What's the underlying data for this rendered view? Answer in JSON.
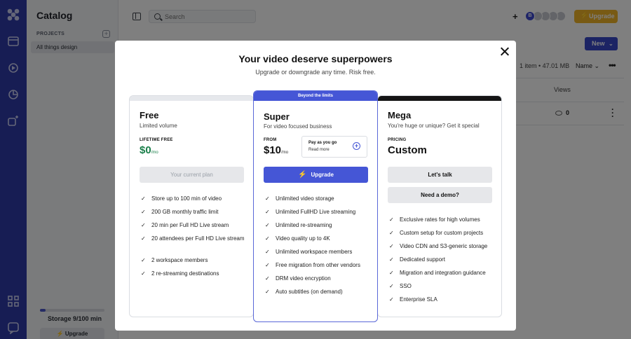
{
  "sidebar": {
    "title": "Catalog",
    "projects_label": "PROJECTS",
    "item": "All things design",
    "storage_text": "Storage 9/100 min",
    "storage_fraction": 0.09,
    "upgrade_label": "Upgrade"
  },
  "topbar": {
    "search_placeholder": "Search",
    "avatar_initial": "B",
    "upgrade_label": "Upgrade"
  },
  "content": {
    "new_label": "New",
    "meta": "1 item • 47.01 MB",
    "sort_label": "Name",
    "views_header": "Views",
    "views_value": "0"
  },
  "modal": {
    "title": "Your video deserve superpowers",
    "subtitle": "Upgrade or downgrade any time. Risk free.",
    "plans": {
      "free": {
        "name": "Free",
        "desc": "Limited volume",
        "price_label": "LIFETIME FREE",
        "price": "$0",
        "per": "/mo",
        "button": "Your current plan",
        "features": [
          "Store up to 100 min of video",
          "200 GB monthly traffic limit",
          "20 min per Full HD Live stream",
          "20 attendees per Full HD Live stream",
          "2 workspace members",
          "2 re-streaming destinations"
        ]
      },
      "super": {
        "banner": "Beyond the limits",
        "name": "Super",
        "desc": "For video focused business",
        "price_label": "FROM",
        "price": "$10",
        "per": "/mo",
        "payg_title": "Pay as you go",
        "payg_link": "Read more",
        "button": "Upgrade",
        "features": [
          "Unlimited video storage",
          "Unlimited FullHD Live streaming",
          "Unlimited re-streaming",
          "Video quality up to 4K",
          "Unlimited workspace members",
          "Free migration from other vendors",
          "DRM video encryption",
          "Auto subtitles (on demand)"
        ]
      },
      "mega": {
        "name": "Mega",
        "desc": "You're huge or unique? Get it special",
        "price_label": "PRICING",
        "price": "Custom",
        "button": "Let's talk",
        "button2": "Need a demo?",
        "features": [
          "Exclusive rates for high volumes",
          "Custom setup for custom projects",
          "Video CDN and S3-generic storage",
          "Dedicated support",
          "Migration and integration guidance",
          "SSO",
          "Enterprise SLA"
        ]
      }
    }
  },
  "colors": {
    "rail": "#2f3aa8",
    "accent": "#4556d6",
    "upgrade": "#f0b429",
    "free_price": "#1a7f4a"
  }
}
